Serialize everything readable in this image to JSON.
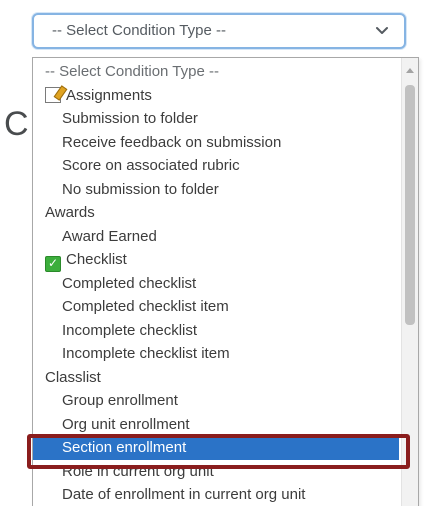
{
  "select": {
    "value": "-- Select Condition Type --",
    "chevron_icon": "chevron-down-icon"
  },
  "background_text": "C",
  "options": [
    {
      "label": "-- Select Condition Type --",
      "kind": "placeholder"
    },
    {
      "label": "Assignments",
      "kind": "group",
      "icon": "assignment-icon"
    },
    {
      "label": "Submission to folder",
      "kind": "child"
    },
    {
      "label": "Receive feedback on submission",
      "kind": "child"
    },
    {
      "label": "Score on associated rubric",
      "kind": "child"
    },
    {
      "label": "No submission to folder",
      "kind": "child"
    },
    {
      "label": "Awards",
      "kind": "group"
    },
    {
      "label": "Award Earned",
      "kind": "child"
    },
    {
      "label": "Checklist",
      "kind": "group",
      "icon": "checklist-icon",
      "glyph": "✓"
    },
    {
      "label": "Completed checklist",
      "kind": "child"
    },
    {
      "label": "Completed checklist item",
      "kind": "child"
    },
    {
      "label": "Incomplete checklist",
      "kind": "child"
    },
    {
      "label": "Incomplete checklist item",
      "kind": "child"
    },
    {
      "label": "Classlist",
      "kind": "group"
    },
    {
      "label": "Group enrollment",
      "kind": "child"
    },
    {
      "label": "Org unit enrollment",
      "kind": "child"
    },
    {
      "label": "Section enrollment",
      "kind": "child",
      "selected": true
    },
    {
      "label": "Role in current org unit",
      "kind": "child"
    },
    {
      "label": "Date of enrollment in current org unit",
      "kind": "child"
    }
  ],
  "colors": {
    "selected_background": "#2b73c7",
    "highlight_frame": "#8a1d1d",
    "select_border": "#86b4e3"
  }
}
